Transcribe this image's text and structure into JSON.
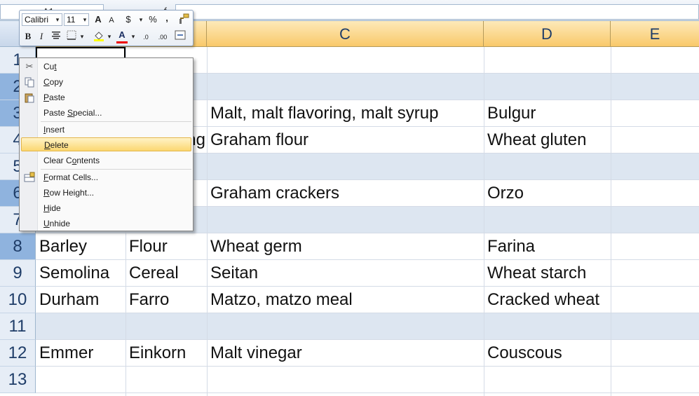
{
  "namebox": {
    "value": "A1"
  },
  "formula_bar": {
    "fx": "f"
  },
  "columns": [
    "C",
    "D",
    "E"
  ],
  "rows": [
    {
      "num": "1"
    },
    {
      "num": "2"
    },
    {
      "num": "3",
      "c": "Malt, malt flavoring, malt syrup",
      "d": "Bulgur"
    },
    {
      "num": "4",
      "b": "ng",
      "c": "Graham flour",
      "d": "Wheat gluten"
    },
    {
      "num": "5"
    },
    {
      "num": "6",
      "c": "Graham crackers",
      "d": "Orzo"
    },
    {
      "num": "7"
    },
    {
      "num": "8",
      "a": "Barley",
      "b": "Flour",
      "c": "Wheat germ",
      "d": "Farina"
    },
    {
      "num": "9",
      "a": "Semolina",
      "b": "Cereal",
      "c": "Seitan",
      "d": "Wheat starch"
    },
    {
      "num": "10",
      "a": "Durham",
      "b": "Farro",
      "c": "Matzo, matzo meal",
      "d": "Cracked wheat"
    },
    {
      "num": "11"
    },
    {
      "num": "12",
      "a": "Emmer",
      "b": "Einkorn",
      "c": "Malt vinegar",
      "d": "Couscous"
    },
    {
      "num": "13"
    }
  ],
  "mini_toolbar": {
    "font": "Calibri",
    "size": "11",
    "grow": "A",
    "shrink": "A",
    "currency": "$",
    "percent": "%",
    "comma": ",",
    "bold": "B",
    "italic": "I",
    "font_color": "A",
    "inc_decimal": ".0",
    "dec_decimal": ".00"
  },
  "context_menu": {
    "items": [
      {
        "label": "Cut",
        "icon": "scissors-icon"
      },
      {
        "label": "Copy",
        "icon": "copy-icon"
      },
      {
        "label": "Paste",
        "icon": "paste-icon"
      },
      {
        "label": "Paste Special..."
      },
      {
        "label": "Insert"
      },
      {
        "label": "Delete"
      },
      {
        "label": "Clear Contents"
      },
      {
        "label": "Format Cells...",
        "icon": "format-cells-icon"
      },
      {
        "label": "Row Height..."
      },
      {
        "label": "Hide"
      },
      {
        "label": "Unhide"
      }
    ]
  },
  "colors": {
    "header_selected": "#8fb3de",
    "band": "#dde6f1",
    "menu_highlight": "#fbd771"
  }
}
